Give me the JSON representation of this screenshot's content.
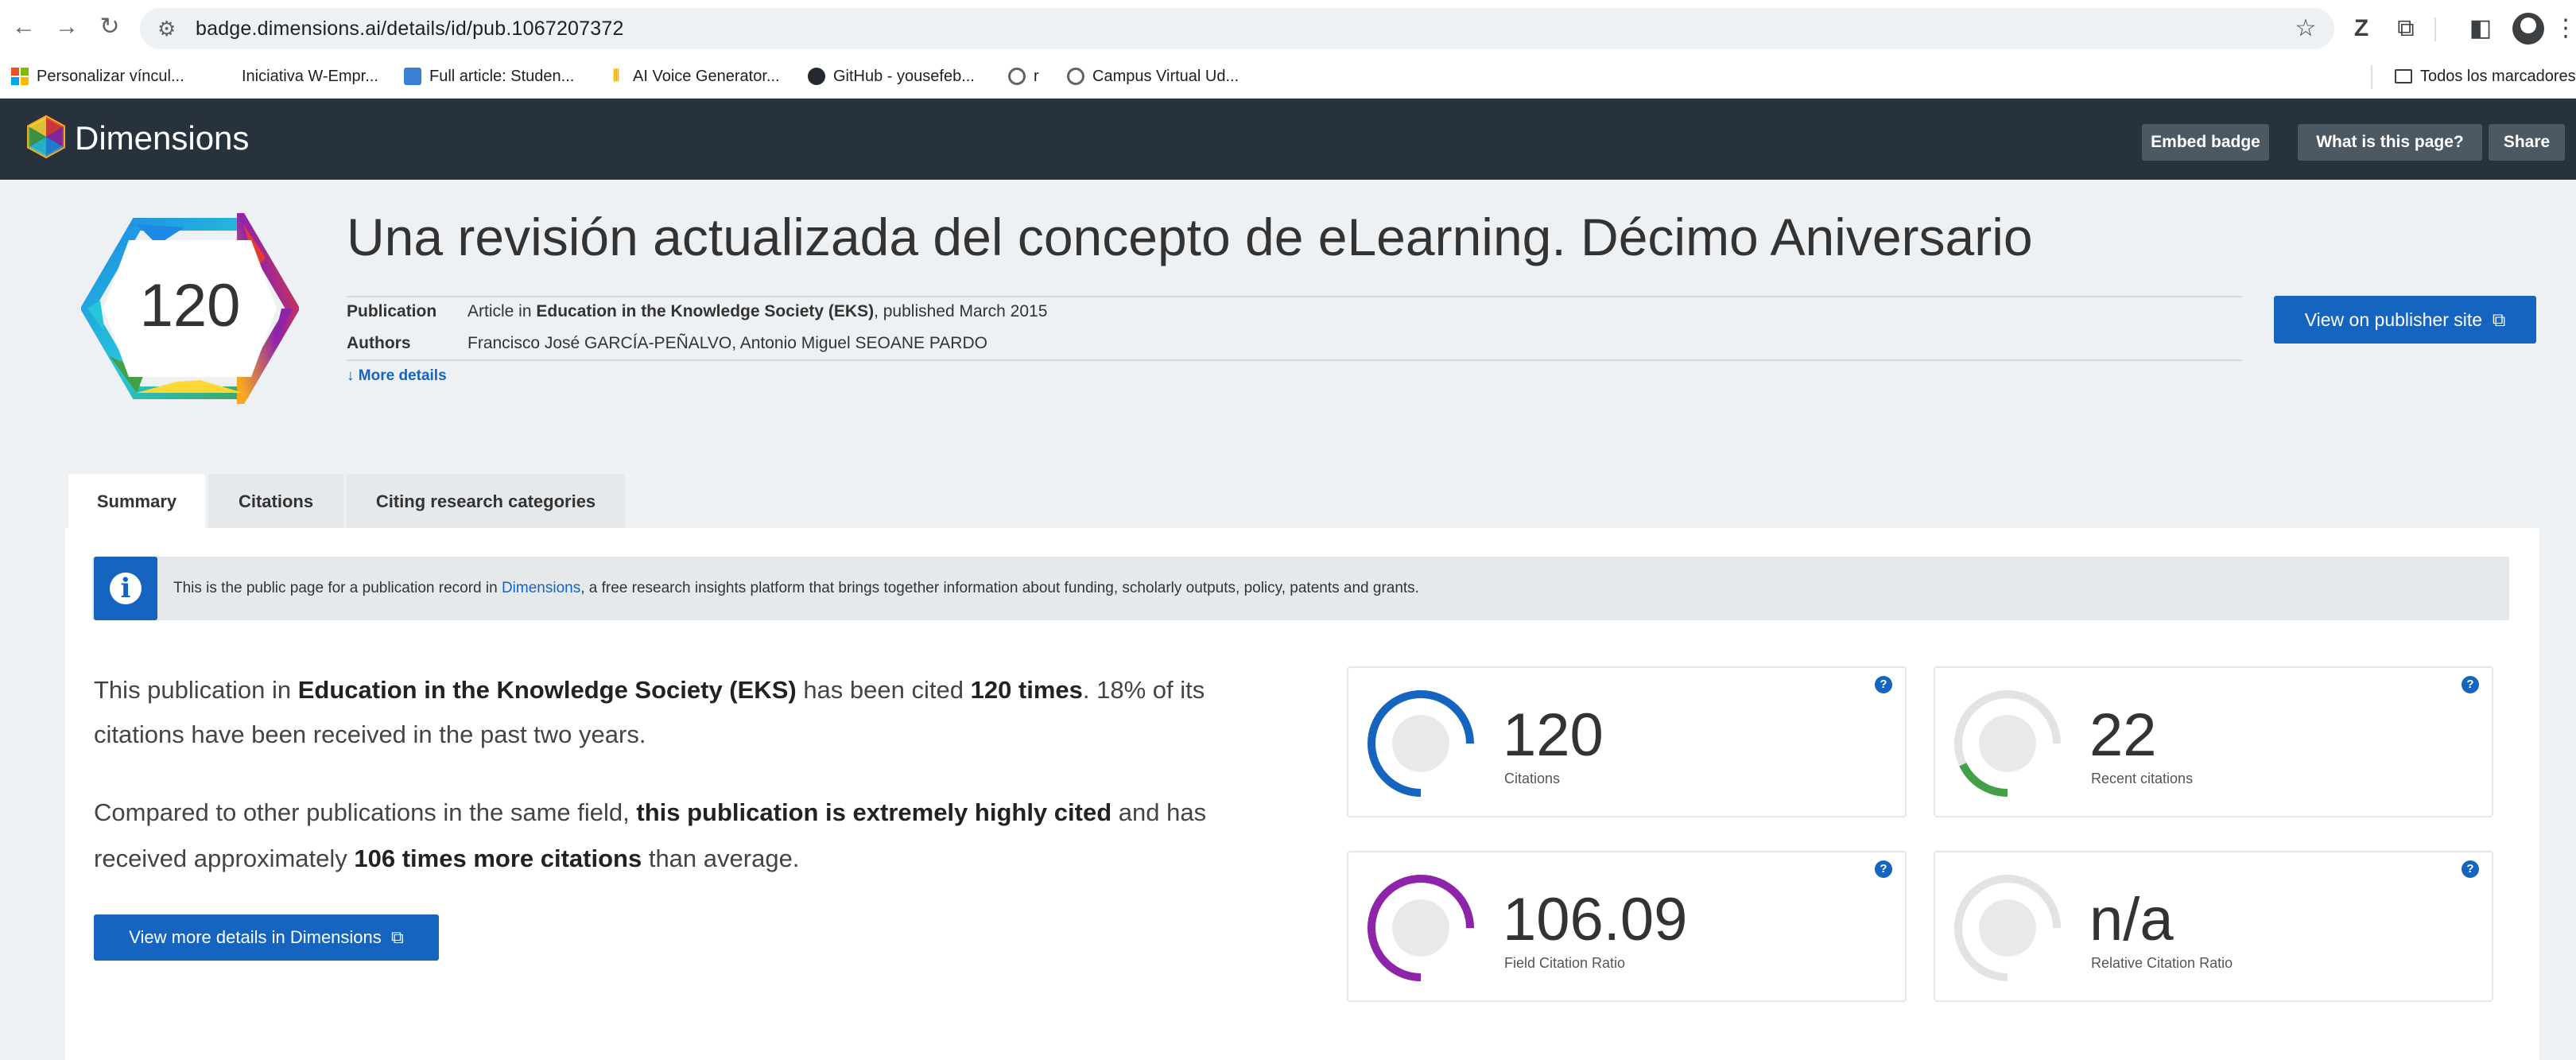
{
  "browser": {
    "url": "badge.dimensions.ai/details/id/pub.1067207372",
    "bookmarks": [
      {
        "label": "Personalizar víncul..."
      },
      {
        "label": "Iniciativa W-Empr..."
      },
      {
        "label": "Full article: Studen..."
      },
      {
        "label": "AI Voice Generator..."
      },
      {
        "label": "GitHub - yousefeb..."
      },
      {
        "label": "r"
      },
      {
        "label": "Campus Virtual Ud..."
      }
    ],
    "all_bookmarks_label": "Todos los marcadores"
  },
  "header": {
    "brand": "Dimensions",
    "buttons": {
      "embed": "Embed badge",
      "what": "What is this page?",
      "share": "Share"
    }
  },
  "publication": {
    "badge_count": "120",
    "title": "Una revisión actualizada del concepto de eLearning. Décimo Aniversario",
    "publication_label": "Publication",
    "publication_prefix": "Article in ",
    "journal": "Education in the Knowledge Society (EKS)",
    "publication_suffix": ", published March 2015",
    "authors_label": "Authors",
    "authors": "Francisco José GARCÍA-PEÑALVO, Antonio Miguel SEOANE PARDO",
    "more_details": "More details",
    "publisher_button": "View on publisher site"
  },
  "tabs": [
    {
      "label": "Summary",
      "active": true
    },
    {
      "label": "Citations",
      "active": false
    },
    {
      "label": "Citing research categories",
      "active": false
    }
  ],
  "info": {
    "text_before": "This is the public page for a publication record in ",
    "link": "Dimensions",
    "text_after": ", a free research insights platform that brings together information about funding, scholarly outputs, policy, patents and grants."
  },
  "summary": {
    "p1_a": "This publication in ",
    "p1_journal": "Education in the Knowledge Society (EKS)",
    "p1_b": " has been cited ",
    "p1_count": "120 times",
    "p1_c": ". 18% of its",
    "p1_line2": "citations have been received in the past two years.",
    "p2_a": "Compared to other publications in the same field, ",
    "p2_bold": "this publication is extremely highly cited",
    "p2_b": " and has",
    "p2_c": "received approximately ",
    "p2_bold2": "106 times more citations",
    "p2_d": " than average.",
    "more_button": "View more details in Dimensions"
  },
  "metrics": [
    {
      "value": "120",
      "label": "Citations",
      "color": "#1565c0",
      "fill": 0.75
    },
    {
      "value": "22",
      "label": "Recent citations",
      "color": "#43a047",
      "fill": 0.18
    },
    {
      "value": "106.09",
      "label": "Field Citation Ratio",
      "color": "#8e24aa",
      "fill": 0.75
    },
    {
      "value": "n/a",
      "label": "Relative Citation Ratio",
      "color": "#cccccc",
      "fill": 0
    }
  ],
  "colors": {
    "accent": "#1565c0",
    "header_bg": "#27323c"
  }
}
